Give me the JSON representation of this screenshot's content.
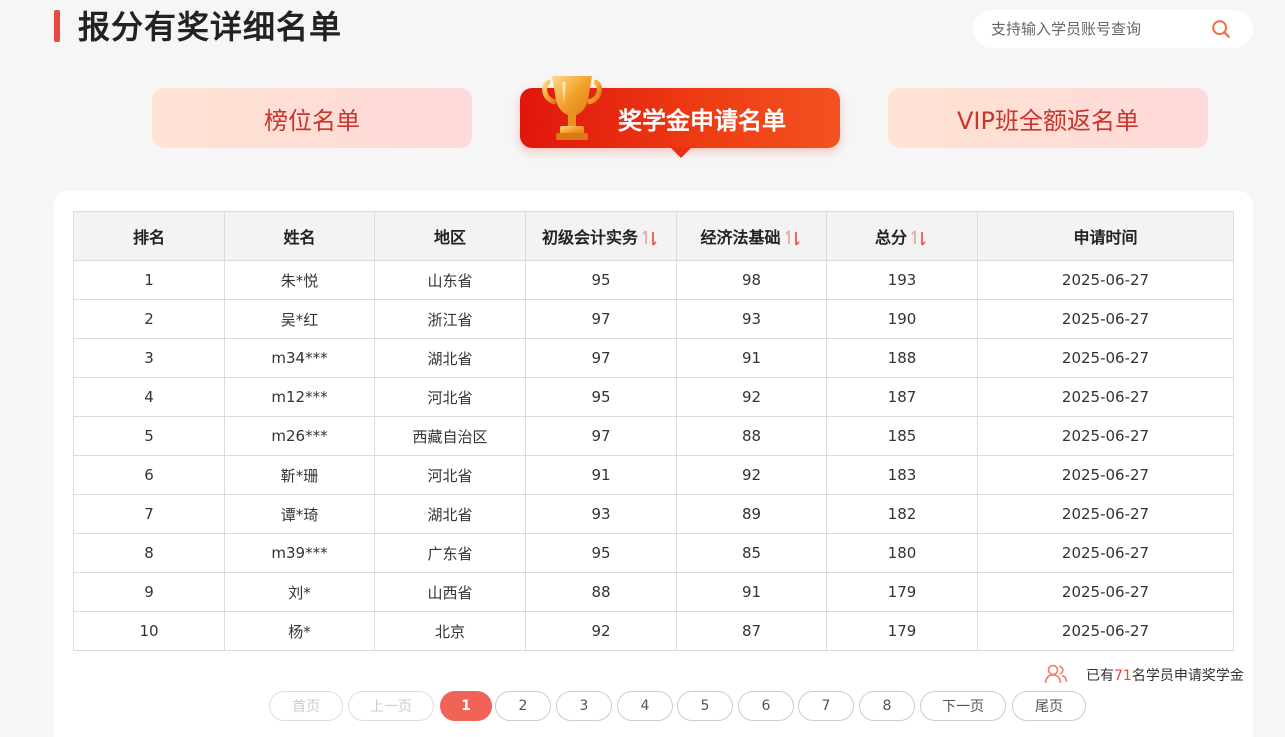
{
  "header": {
    "title": "报分有奖详细名单",
    "search_placeholder": "支持输入学员账号查询"
  },
  "tabs": [
    {
      "label": "榜位名单",
      "active": false
    },
    {
      "label": "奖学金申请名单",
      "active": true
    },
    {
      "label": "VIP班全额返名单",
      "active": false
    }
  ],
  "table": {
    "columns": [
      "排名",
      "姓名",
      "地区",
      "初级会计实务",
      "经济法基础",
      "总分",
      "申请时间"
    ],
    "rows": [
      [
        "1",
        "朱*悦",
        "山东省",
        "95",
        "98",
        "193",
        "2025-06-27"
      ],
      [
        "2",
        "吴*红",
        "浙江省",
        "97",
        "93",
        "190",
        "2025-06-27"
      ],
      [
        "3",
        "m34***",
        "湖北省",
        "97",
        "91",
        "188",
        "2025-06-27"
      ],
      [
        "4",
        "m12***",
        "河北省",
        "95",
        "92",
        "187",
        "2025-06-27"
      ],
      [
        "5",
        "m26***",
        "西藏自治区",
        "97",
        "88",
        "185",
        "2025-06-27"
      ],
      [
        "6",
        "靳*珊",
        "河北省",
        "91",
        "92",
        "183",
        "2025-06-27"
      ],
      [
        "7",
        "谭*琦",
        "湖北省",
        "93",
        "89",
        "182",
        "2025-06-27"
      ],
      [
        "8",
        "m39***",
        "广东省",
        "95",
        "85",
        "180",
        "2025-06-27"
      ],
      [
        "9",
        "刘*",
        "山西省",
        "88",
        "91",
        "179",
        "2025-06-27"
      ],
      [
        "10",
        "杨*",
        "北京",
        "92",
        "87",
        "179",
        "2025-06-27"
      ]
    ]
  },
  "summary": {
    "prefix": "已有",
    "count": "71",
    "suffix": "名学员申请奖学金"
  },
  "pagination": {
    "first": "首页",
    "prev": "上一页",
    "pages": [
      "1",
      "2",
      "3",
      "4",
      "5",
      "6",
      "7",
      "8"
    ],
    "current": "1",
    "next": "下一页",
    "last": "尾页"
  },
  "colors": {
    "accent": "#e8483d",
    "active_tab": "#e0160c",
    "pager_active": "#f26357"
  }
}
